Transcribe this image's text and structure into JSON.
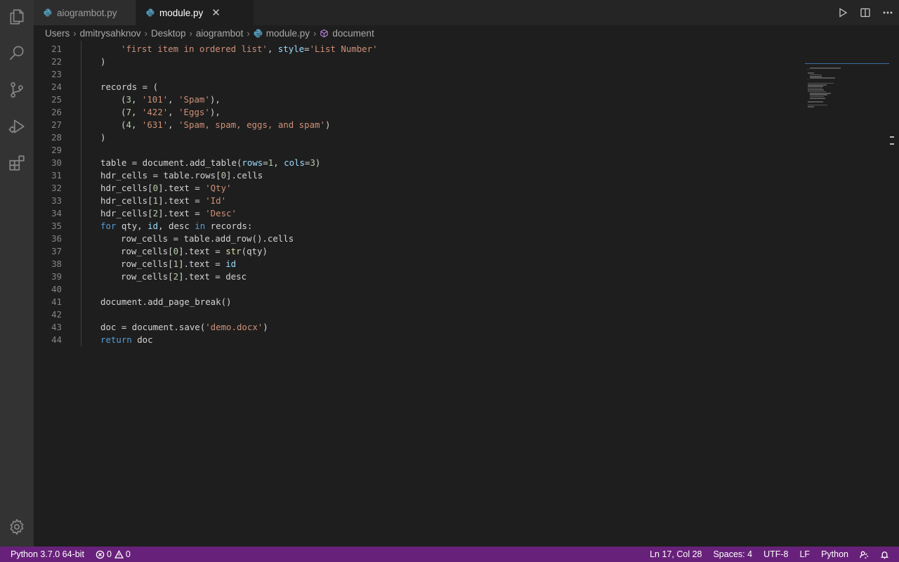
{
  "tabs": [
    {
      "label": "aiogrambot.py",
      "active": false
    },
    {
      "label": "module.py",
      "active": true
    }
  ],
  "breadcrumb": [
    "Users",
    "dmitrysahknov",
    "Desktop",
    "aiogrambot",
    "module.py",
    "document"
  ],
  "activity_bar": [
    "files-icon",
    "search-icon",
    "source-control-icon",
    "run-debug-icon",
    "extensions-icon",
    "settings-gear-icon"
  ],
  "tab_actions": [
    "run-icon",
    "split-editor-icon",
    "more-actions-icon"
  ],
  "code_lines": [
    {
      "n": "21",
      "indent": 8,
      "tokens": [
        [
          "str",
          "'first item in ordered list'"
        ],
        [
          "p",
          ", "
        ],
        [
          "prm",
          "style"
        ],
        [
          "p",
          "="
        ],
        [
          "str",
          "'List Number'"
        ]
      ]
    },
    {
      "n": "22",
      "indent": 4,
      "tokens": [
        [
          "p",
          ")"
        ]
      ]
    },
    {
      "n": "23",
      "indent": 0,
      "tokens": []
    },
    {
      "n": "24",
      "indent": 4,
      "tokens": [
        [
          "p",
          "records = ("
        ]
      ]
    },
    {
      "n": "25",
      "indent": 8,
      "tokens": [
        [
          "p",
          "("
        ],
        [
          "num",
          "3"
        ],
        [
          "p",
          ", "
        ],
        [
          "str",
          "'101'"
        ],
        [
          "p",
          ", "
        ],
        [
          "str",
          "'Spam'"
        ],
        [
          "p",
          "),"
        ]
      ]
    },
    {
      "n": "26",
      "indent": 8,
      "tokens": [
        [
          "p",
          "("
        ],
        [
          "num",
          "7"
        ],
        [
          "p",
          ", "
        ],
        [
          "str",
          "'422'"
        ],
        [
          "p",
          ", "
        ],
        [
          "str",
          "'Eggs'"
        ],
        [
          "p",
          "),"
        ]
      ]
    },
    {
      "n": "27",
      "indent": 8,
      "tokens": [
        [
          "p",
          "("
        ],
        [
          "num",
          "4"
        ],
        [
          "p",
          ", "
        ],
        [
          "str",
          "'631'"
        ],
        [
          "p",
          ", "
        ],
        [
          "str",
          "'Spam, spam, eggs, and spam'"
        ],
        [
          "p",
          ")"
        ]
      ]
    },
    {
      "n": "28",
      "indent": 4,
      "tokens": [
        [
          "p",
          ")"
        ]
      ]
    },
    {
      "n": "29",
      "indent": 0,
      "tokens": []
    },
    {
      "n": "30",
      "indent": 4,
      "tokens": [
        [
          "p",
          "table = document.add_table("
        ],
        [
          "prm",
          "rows"
        ],
        [
          "p",
          "="
        ],
        [
          "num",
          "1"
        ],
        [
          "p",
          ", "
        ],
        [
          "prm",
          "cols"
        ],
        [
          "p",
          "="
        ],
        [
          "num",
          "3"
        ],
        [
          "p",
          ")"
        ]
      ]
    },
    {
      "n": "31",
      "indent": 4,
      "tokens": [
        [
          "p",
          "hdr_cells = table.rows["
        ],
        [
          "num",
          "0"
        ],
        [
          "p",
          "].cells"
        ]
      ]
    },
    {
      "n": "32",
      "indent": 4,
      "tokens": [
        [
          "p",
          "hdr_cells["
        ],
        [
          "num",
          "0"
        ],
        [
          "p",
          "].text = "
        ],
        [
          "str",
          "'Qty'"
        ]
      ]
    },
    {
      "n": "33",
      "indent": 4,
      "tokens": [
        [
          "p",
          "hdr_cells["
        ],
        [
          "num",
          "1"
        ],
        [
          "p",
          "].text = "
        ],
        [
          "str",
          "'Id'"
        ]
      ]
    },
    {
      "n": "34",
      "indent": 4,
      "tokens": [
        [
          "p",
          "hdr_cells["
        ],
        [
          "num",
          "2"
        ],
        [
          "p",
          "].text = "
        ],
        [
          "str",
          "'Desc'"
        ]
      ]
    },
    {
      "n": "35",
      "indent": 4,
      "tokens": [
        [
          "kw",
          "for"
        ],
        [
          "p",
          " qty, "
        ],
        [
          "var",
          "id"
        ],
        [
          "p",
          ", desc "
        ],
        [
          "kw",
          "in"
        ],
        [
          "p",
          " records:"
        ]
      ]
    },
    {
      "n": "36",
      "indent": 8,
      "tokens": [
        [
          "p",
          "row_cells = table.add_row().cells"
        ]
      ]
    },
    {
      "n": "37",
      "indent": 8,
      "tokens": [
        [
          "p",
          "row_cells["
        ],
        [
          "num",
          "0"
        ],
        [
          "p",
          "].text = "
        ],
        [
          "fn",
          "str"
        ],
        [
          "p",
          "(qty)"
        ]
      ]
    },
    {
      "n": "38",
      "indent": 8,
      "tokens": [
        [
          "p",
          "row_cells["
        ],
        [
          "num",
          "1"
        ],
        [
          "p",
          "].text = "
        ],
        [
          "var",
          "id"
        ]
      ]
    },
    {
      "n": "39",
      "indent": 8,
      "tokens": [
        [
          "p",
          "row_cells["
        ],
        [
          "num",
          "2"
        ],
        [
          "p",
          "].text = desc"
        ]
      ]
    },
    {
      "n": "40",
      "indent": 0,
      "tokens": []
    },
    {
      "n": "41",
      "indent": 4,
      "tokens": [
        [
          "p",
          "document.add_page_break()"
        ]
      ]
    },
    {
      "n": "42",
      "indent": 0,
      "tokens": []
    },
    {
      "n": "43",
      "indent": 4,
      "tokens": [
        [
          "p",
          "doc = document.save("
        ],
        [
          "str",
          "'demo.docx'"
        ],
        [
          "p",
          ")"
        ]
      ]
    },
    {
      "n": "44",
      "indent": 4,
      "tokens": [
        [
          "kw",
          "return"
        ],
        [
          "p",
          " doc"
        ]
      ]
    }
  ],
  "status": {
    "interpreter": "Python 3.7.0 64-bit",
    "errors": "0",
    "warnings": "0",
    "position": "Ln 17, Col 28",
    "spaces": "Spaces: 4",
    "encoding": "UTF-8",
    "eol": "LF",
    "language": "Python"
  },
  "colors": {
    "status_bar": "#68217a",
    "editor_bg": "#1e1e1e",
    "activity_bar": "#333333",
    "string": "#ce9178",
    "keyword": "#569cd6",
    "number": "#b5cea8",
    "parameter": "#9cdcfe"
  }
}
